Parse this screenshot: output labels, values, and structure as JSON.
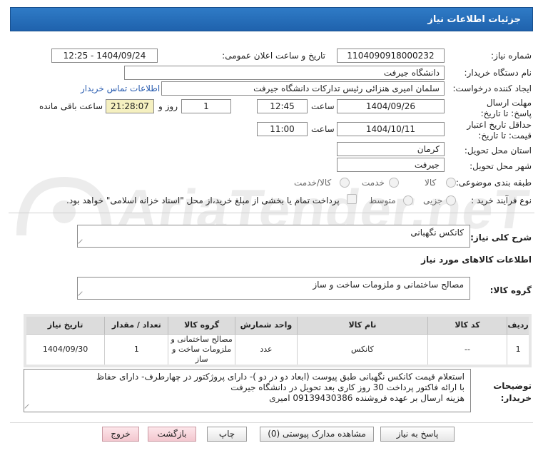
{
  "header": {
    "title": "جزئیات اطلاعات نیاز"
  },
  "need_number": {
    "label": "شماره نیاز:",
    "value": "1104090918000232"
  },
  "announce": {
    "label": "تاریخ و ساعت اعلان عمومی:",
    "value": "1404/09/24 - 12:25"
  },
  "buyer_org": {
    "label": "نام دستگاه خریدار:",
    "value": "دانشگاه جیرفت"
  },
  "requester": {
    "label": "ایجاد کننده درخواست:",
    "value": "سلمان امیری هنزائی رئیس تدارکات دانشگاه جیرفت",
    "contact_link": "اطلاعات تماس خریدار"
  },
  "deadline": {
    "label": "مهلت ارسال پاسخ: تا تاریخ:",
    "date": "1404/09/26",
    "time_label": "ساعت",
    "time": "12:45",
    "days": "1",
    "days_label": "روز و",
    "remaining": "21:28:07",
    "remaining_label": "ساعت باقی مانده"
  },
  "validity": {
    "label": "حداقل تاریخ اعتبار قیمت: تا تاریخ:",
    "date": "1404/10/11",
    "time_label": "ساعت",
    "time": "11:00"
  },
  "province": {
    "label": "استان محل تحویل:",
    "value": "کرمان"
  },
  "city": {
    "label": "شهر محل تحویل:",
    "value": "جیرفت"
  },
  "category": {
    "label": "طبقه بندی موضوعی:",
    "options": [
      "کالا",
      "خدمت",
      "کالا/خدمت"
    ],
    "selected": "کالا"
  },
  "process": {
    "label": "نوع فرآیند خرید :",
    "options": [
      "جزیی",
      "متوسط"
    ],
    "checkbox_text": "پرداخت تمام یا بخشی از مبلغ خرید،از محل \"اسناد خزانه اسلامی\" خواهد بود."
  },
  "summary": {
    "label": "شرح کلی نیاز:",
    "value": "کانکس نگهبانی"
  },
  "goods_section": {
    "title": "اطلاعات کالاهای مورد نیاز"
  },
  "goods_group": {
    "label": "گروه کالا:",
    "value": "مصالح ساختمانی و ملزومات ساخت و ساز"
  },
  "table": {
    "headers": [
      "ردیف",
      "کد کالا",
      "نام کالا",
      "واحد شمارش",
      "گروه کالا",
      "تعداد / مقدار",
      "تاریخ نیاز"
    ],
    "rows": [
      [
        "1",
        "--",
        "کانکس",
        "عدد",
        "مصالح ساختمانی و ملزومات ساخت و ساز",
        "1",
        "1404/09/30"
      ]
    ]
  },
  "buyer_notes": {
    "label": "توضیحات خریدار:",
    "lines": [
      "استعلام قیمت کانکس نگهبانی طبق پیوست (ابعاد دو در دو )- دارای پروژکتور در چهارطرف- دارای حفاظ",
      "با ارائه فاکتور پرداخت 30 روز کاری بعد تحویل در دانشگاه جیرفت",
      "هزینه ارسال بر عهده فروشنده 09139430386 امیری"
    ]
  },
  "buttons": {
    "reply": "پاسخ به نیاز",
    "docs": "مشاهده مدارک پیوستی (0)",
    "print": "چاپ",
    "back": "بازگشت",
    "exit": "خروج"
  }
}
